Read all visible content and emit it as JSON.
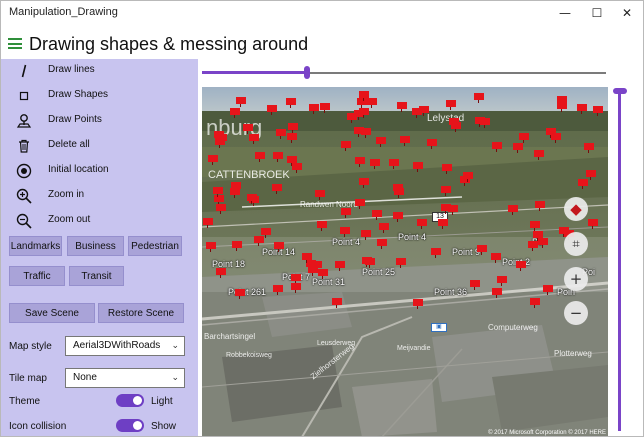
{
  "window": {
    "title": "Manipulation_Drawing",
    "minimize_glyph": "—",
    "maximize_glyph": "☐",
    "close_glyph": "✕"
  },
  "header": {
    "title": "Drawing shapes & messing around",
    "menu_icon": "hamburger-icon",
    "accent_color": "#2f8f3a"
  },
  "pane": {
    "background": "#c8c4ef",
    "commands": [
      {
        "label": "Draw lines",
        "icon": "pen-icon"
      },
      {
        "label": "Draw Shapes",
        "icon": "square-outline-icon"
      },
      {
        "label": "Draw Points",
        "icon": "map-pin-icon"
      },
      {
        "label": "Delete all",
        "icon": "trash-icon"
      },
      {
        "label": "Initial location",
        "icon": "target-icon"
      },
      {
        "label": "Zoom in",
        "icon": "zoom-in-icon"
      },
      {
        "label": "Zoom out",
        "icon": "zoom-out-icon"
      }
    ],
    "layer_buttons": [
      "Landmarks",
      "Business",
      "Pedestrian"
    ],
    "layer_buttons_2": [
      "Traffic",
      "Transit"
    ],
    "scene_buttons": [
      "Save Scene",
      "Restore Scene"
    ],
    "map_style": {
      "label": "Map style",
      "value": "Aerial3DWithRoads"
    },
    "tile_map": {
      "label": "Tile map",
      "value": "None"
    },
    "theme": {
      "label": "Theme",
      "value": "Light",
      "on": true
    },
    "icon_collision": {
      "label": "Icon collision",
      "value": "Show",
      "on": true
    }
  },
  "sliders": {
    "accent": "#7a44c8",
    "horizontal_fraction": 0.26,
    "vertical_fraction": 0.0
  },
  "map": {
    "city_labels": [
      "nburg",
      "Lelystad",
      "CATTENBROEK",
      "Randwen Noord"
    ],
    "road_labels": [
      "Zielhorsterweg",
      "Computerweg",
      "Plotterweg",
      "Robbekoisweg",
      "Meijvandie",
      "Leusderweg",
      "Barchartsingel"
    ],
    "shield_label": "13",
    "point_labels": [
      "Point 261",
      "Point 36",
      "Point 25",
      "Point 14",
      "Point 2",
      "Point 4",
      "Point 31",
      "Point 9",
      "Point 18",
      "Poi",
      "Po",
      "Poin",
      "Point 4",
      "Point 7"
    ],
    "copyright": "© 2017 Microsoft Corporation © 2017 HERE",
    "controls": [
      {
        "name": "compass",
        "glyph": "◆"
      },
      {
        "name": "tilt",
        "glyph": "⌗"
      },
      {
        "name": "zoom-in",
        "glyph": "+"
      },
      {
        "name": "zoom-out",
        "glyph": "−"
      }
    ]
  }
}
